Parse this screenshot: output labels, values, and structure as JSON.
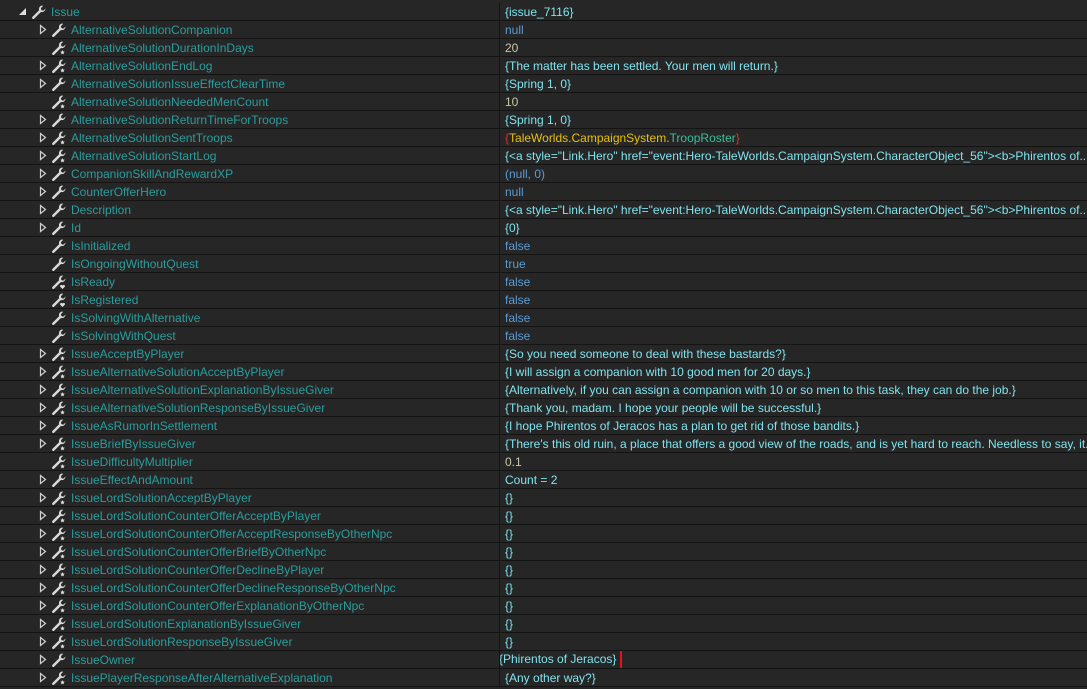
{
  "colors": {
    "name": "#2a9d9d",
    "value": "#7fe3ee",
    "keyword": "#5b9bd5",
    "number": "#c9c9a6",
    "highlight_box": "#e0141e"
  },
  "rows": [
    {
      "name": "Issue",
      "value": "{issue_7116}",
      "level": 0,
      "expand": "expanded",
      "icon": "wrench-icon",
      "type": "str"
    },
    {
      "name": "AlternativeSolutionCompanion",
      "value": "null",
      "level": 1,
      "expand": "collapsed",
      "icon": "wrench-icon",
      "type": "kw"
    },
    {
      "name": "AlternativeSolutionDurationInDays",
      "value": "20",
      "level": 1,
      "expand": "none",
      "icon": "static-wrench-icon",
      "type": "num"
    },
    {
      "name": "AlternativeSolutionEndLog",
      "value": "{The matter has been settled. Your men will return.}",
      "level": 1,
      "expand": "collapsed",
      "icon": "static-wrench-icon",
      "type": "str"
    },
    {
      "name": "AlternativeSolutionIssueEffectClearTime",
      "value": "{Spring 1, 0}",
      "level": 1,
      "expand": "collapsed",
      "icon": "wrench-icon",
      "type": "str"
    },
    {
      "name": "AlternativeSolutionNeededMenCount",
      "value": "10",
      "level": 1,
      "expand": "none",
      "icon": "static-wrench-icon",
      "type": "num"
    },
    {
      "name": "AlternativeSolutionReturnTimeForTroops",
      "value": "{Spring 1, 0}",
      "level": 1,
      "expand": "collapsed",
      "icon": "wrench-icon",
      "type": "str"
    },
    {
      "name": "AlternativeSolutionSentTroops",
      "value": "{TaleWorlds.CampaignSystem.TroopRoster}",
      "level": 1,
      "expand": "collapsed",
      "icon": "static-wrench-icon",
      "type": "type",
      "parts": [
        "{",
        "TaleWorlds.CampaignSystem.",
        "TroopRoster",
        "}"
      ]
    },
    {
      "name": "AlternativeSolutionStartLog",
      "value": "{<a style=\"Link.Hero\" href=\"event:Hero-TaleWorlds.CampaignSystem.CharacterObject_56\"><b>Phirentos of...",
      "level": 1,
      "expand": "collapsed",
      "icon": "static-wrench-icon",
      "type": "str"
    },
    {
      "name": "CompanionSkillAndRewardXP",
      "value": "(null, 0)",
      "level": 1,
      "expand": "collapsed",
      "icon": "wrench-icon",
      "type": "kw"
    },
    {
      "name": "CounterOfferHero",
      "value": "null",
      "level": 1,
      "expand": "collapsed",
      "icon": "wrench-icon",
      "type": "kw"
    },
    {
      "name": "Description",
      "value": "{<a style=\"Link.Hero\" href=\"event:Hero-TaleWorlds.CampaignSystem.CharacterObject_56\"><b>Phirentos of...",
      "level": 1,
      "expand": "collapsed",
      "icon": "wrench-icon",
      "type": "str"
    },
    {
      "name": "Id",
      "value": "{0}",
      "level": 1,
      "expand": "collapsed",
      "icon": "wrench-icon",
      "type": "str"
    },
    {
      "name": "IsInitialized",
      "value": "false",
      "level": 1,
      "expand": "none",
      "icon": "wrench-icon",
      "type": "kw"
    },
    {
      "name": "IsOngoingWithoutQuest",
      "value": "true",
      "level": 1,
      "expand": "none",
      "icon": "wrench-icon",
      "type": "kw"
    },
    {
      "name": "IsReady",
      "value": "false",
      "level": 1,
      "expand": "none",
      "icon": "private-wrench-icon",
      "type": "kw"
    },
    {
      "name": "IsRegistered",
      "value": "false",
      "level": 1,
      "expand": "none",
      "icon": "private-wrench-icon",
      "type": "kw"
    },
    {
      "name": "IsSolvingWithAlternative",
      "value": "false",
      "level": 1,
      "expand": "none",
      "icon": "wrench-icon",
      "type": "kw"
    },
    {
      "name": "IsSolvingWithQuest",
      "value": "false",
      "level": 1,
      "expand": "none",
      "icon": "wrench-icon",
      "type": "kw"
    },
    {
      "name": "IssueAcceptByPlayer",
      "value": "{So you need someone to deal with these bastards?}",
      "level": 1,
      "expand": "collapsed",
      "icon": "static-wrench-icon",
      "type": "str"
    },
    {
      "name": "IssueAlternativeSolutionAcceptByPlayer",
      "value": "{I will assign a companion with 10 good men for 20 days.}",
      "level": 1,
      "expand": "collapsed",
      "icon": "static-wrench-icon",
      "type": "str"
    },
    {
      "name": "IssueAlternativeSolutionExplanationByIssueGiver",
      "value": "{Alternatively, if you can assign a companion with 10 or so men to this task, they can do the job.}",
      "level": 1,
      "expand": "collapsed",
      "icon": "static-wrench-icon",
      "type": "str"
    },
    {
      "name": "IssueAlternativeSolutionResponseByIssueGiver",
      "value": "{Thank you, madam. I hope your people will be successful.}",
      "level": 1,
      "expand": "collapsed",
      "icon": "static-wrench-icon",
      "type": "str"
    },
    {
      "name": "IssueAsRumorInSettlement",
      "value": "{I hope Phirentos of Jeracos has a plan to get rid of those bandits.}",
      "level": 1,
      "expand": "collapsed",
      "icon": "wrench-icon",
      "type": "str"
    },
    {
      "name": "IssueBriefByIssueGiver",
      "value": "{There's this old ruin, a place that offers a good view of the roads, and is yet hard to reach. Needless to say, it...",
      "level": 1,
      "expand": "collapsed",
      "icon": "static-wrench-icon",
      "type": "str"
    },
    {
      "name": "IssueDifficultyMultiplier",
      "value": "0.1",
      "level": 1,
      "expand": "none",
      "icon": "static-wrench-icon",
      "type": "num"
    },
    {
      "name": "IssueEffectAndAmount",
      "value": "Count = 2",
      "level": 1,
      "expand": "collapsed",
      "icon": "wrench-icon",
      "type": "str"
    },
    {
      "name": "IssueLordSolutionAcceptByPlayer",
      "value": "{}",
      "level": 1,
      "expand": "collapsed",
      "icon": "static-wrench-icon",
      "type": "str"
    },
    {
      "name": "IssueLordSolutionCounterOfferAcceptByPlayer",
      "value": "{}",
      "level": 1,
      "expand": "collapsed",
      "icon": "static-wrench-icon",
      "type": "str"
    },
    {
      "name": "IssueLordSolutionCounterOfferAcceptResponseByOtherNpc",
      "value": "{}",
      "level": 1,
      "expand": "collapsed",
      "icon": "static-wrench-icon",
      "type": "str"
    },
    {
      "name": "IssueLordSolutionCounterOfferBriefByOtherNpc",
      "value": "{}",
      "level": 1,
      "expand": "collapsed",
      "icon": "static-wrench-icon",
      "type": "str"
    },
    {
      "name": "IssueLordSolutionCounterOfferDeclineByPlayer",
      "value": "{}",
      "level": 1,
      "expand": "collapsed",
      "icon": "static-wrench-icon",
      "type": "str"
    },
    {
      "name": "IssueLordSolutionCounterOfferDeclineResponseByOtherNpc",
      "value": "{}",
      "level": 1,
      "expand": "collapsed",
      "icon": "static-wrench-icon",
      "type": "str"
    },
    {
      "name": "IssueLordSolutionCounterOfferExplanationByOtherNpc",
      "value": "{}",
      "level": 1,
      "expand": "collapsed",
      "icon": "static-wrench-icon",
      "type": "str"
    },
    {
      "name": "IssueLordSolutionExplanationByIssueGiver",
      "value": "{}",
      "level": 1,
      "expand": "collapsed",
      "icon": "static-wrench-icon",
      "type": "str"
    },
    {
      "name": "IssueLordSolutionResponseByIssueGiver",
      "value": "{}",
      "level": 1,
      "expand": "collapsed",
      "icon": "static-wrench-icon",
      "type": "str"
    },
    {
      "name": "IssueOwner",
      "value": "{Phirentos of Jeracos}",
      "level": 1,
      "expand": "collapsed",
      "icon": "wrench-icon",
      "type": "str",
      "highlighted": true
    },
    {
      "name": "IssuePlayerResponseAfterAlternativeExplanation",
      "value": "{Any other way?}",
      "level": 1,
      "expand": "collapsed",
      "icon": "static-wrench-icon",
      "type": "str"
    }
  ]
}
